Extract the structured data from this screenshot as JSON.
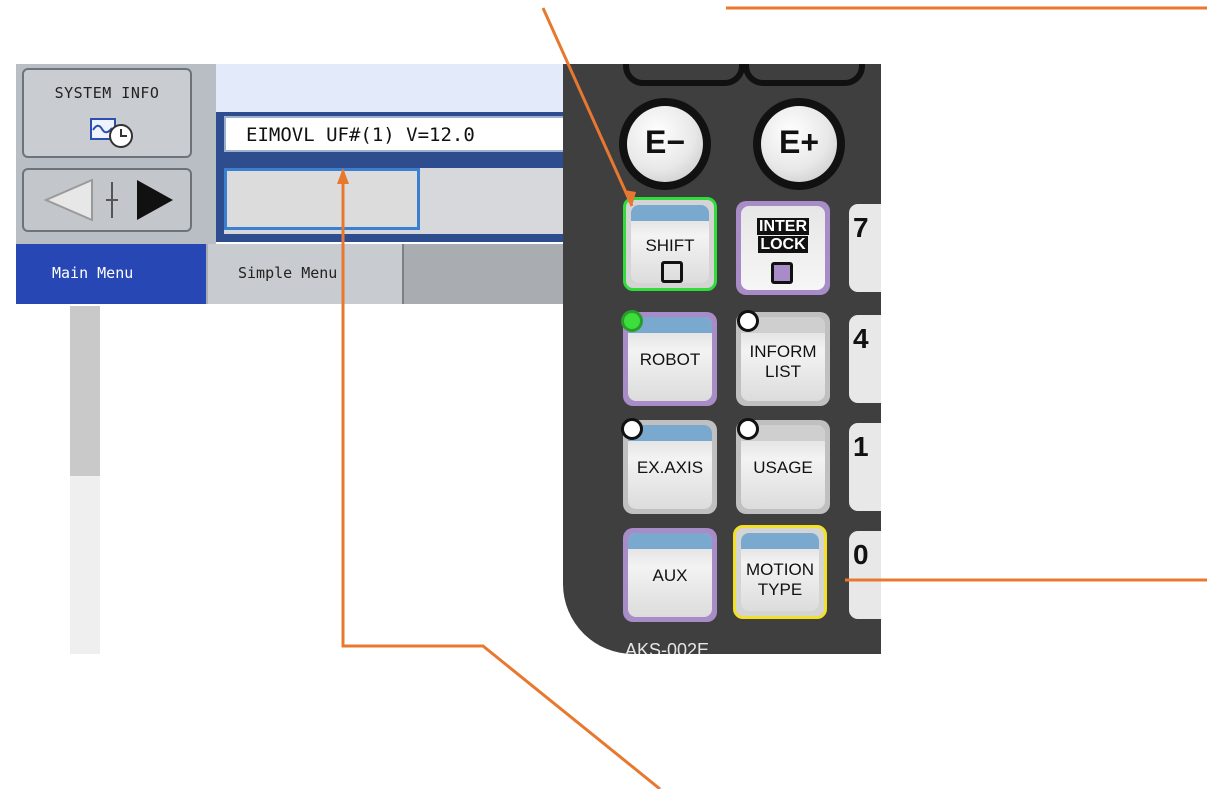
{
  "screen": {
    "system_info_label": "SYSTEM INFO",
    "command_line": "EIMOVL UF#(1) V=12.0",
    "tabs": {
      "main_menu": "Main Menu",
      "simple_menu": "Simple Menu"
    }
  },
  "pendant": {
    "e_minus": "E−",
    "e_plus": "E+",
    "keys": {
      "shift": "SHIFT",
      "interlock_line1": "INTER",
      "interlock_line2": "LOCK",
      "robot": "ROBOT",
      "inform_line1": "INFORM",
      "inform_line2": "LIST",
      "exaxis": "EX.AXIS",
      "usage": "USAGE",
      "aux": "AUX",
      "motion_line1": "MOTION",
      "motion_line2": "TYPE"
    },
    "numkeys": {
      "seven": "7",
      "four": "4",
      "one": "1",
      "zero": "0"
    },
    "model": "AKS-002E"
  },
  "colors": {
    "annotation": "#e8782f",
    "robot_led": "#3cde3c",
    "shift_highlight": "#2fdc3a",
    "motion_highlight": "#f2e02a",
    "main_tab": "#2747b5"
  }
}
